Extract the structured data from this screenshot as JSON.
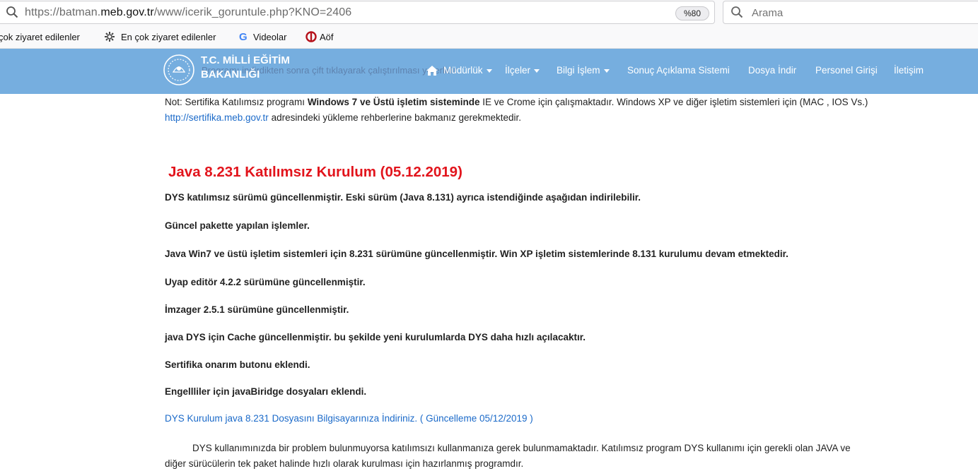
{
  "browser": {
    "url_prefix": "https://batman.",
    "url_domain": "meb.gov.tr",
    "url_suffix": "/www/icerik_goruntule.php?KNO=2406",
    "zoom": "%80",
    "search_placeholder": "Arama"
  },
  "bookmarks": [
    {
      "label": "çok ziyaret edilenler"
    },
    {
      "label": "En çok ziyaret edilenler",
      "icon": "gear-icon"
    },
    {
      "label": "Videolar",
      "icon": "google-icon"
    },
    {
      "label": "Aöf",
      "icon": "aof-icon"
    }
  ],
  "site": {
    "logo_line1": "T.C. MİLLİ EĞİTİM",
    "logo_line2": "BAKANLIĞI",
    "ghost_text": "Programı indirdikten sonra çift tıklayarak çalıştırılması yeterlidir.",
    "nav": [
      {
        "label": "Müdürlük",
        "dropdown": true
      },
      {
        "label": "İlçeler",
        "dropdown": true
      },
      {
        "label": "Bilgi İşlem",
        "dropdown": true
      },
      {
        "label": "Sonuç Açıklama Sistemi",
        "dropdown": false
      },
      {
        "label": "Dosya İndir",
        "dropdown": false
      },
      {
        "label": "Personel Girişi",
        "dropdown": false
      },
      {
        "label": "İletişim",
        "dropdown": false
      }
    ],
    "nav_color": "#76aedf"
  },
  "content": {
    "note_prefix": "Not: Sertifika Katılımsız programı ",
    "note_bold": "Windows 7 ve Üstü işletim sisteminde",
    "note_rest": " IE ve Crome için çalışmaktadır. Windows XP ve diğer işletim sistemleri için (MAC , IOS Vs.)",
    "note_link": "http://sertifika.meb.gov.tr",
    "note_link_rest": " adresindeki yükleme rehberlerine bakmanız gerekmektedir.",
    "heading": "Java 8.231 Katılımsız Kurulum (05.12.2019)",
    "bold_lines": [
      "DYS katılımsız sürümü güncellenmiştir. Eski sürüm (Java 8.131) ayrıca istendiğinde aşağıdan indirilebilir.",
      "Güncel pakette yapılan işlemler.",
      "Java Win7 ve üstü işletim sistemleri için 8.231 sürümüne güncellenmiştir. Win XP işletim sistemlerinde 8.131 kurulumu devam etmektedir.",
      "Uyap editör 4.2.2 sürümüne güncellenmiştir.",
      "İmzager 2.5.1 sürümüne güncellenmiştir.",
      "java DYS için Cache güncellenmiştir. bu şekilde yeni kurulumlarda DYS daha hızlı açılacaktır.",
      "Sertifika onarım butonu eklendi.",
      "Engellliler için javaBiridge dosyaları eklendi."
    ],
    "download_link": "DYS Kurulum java 8.231 Dosyasını Bilgisayarınıza İndiriniz.  ( Güncelleme 05/12/2019 )",
    "para_line1": "DYS kullanımınızda bir problem bulunmuyorsa katılımsızı kullanmanıza gerek bulunmamaktadır. Katılımsız program DYS kullanımı için gerekli olan JAVA ve",
    "para_line2": "diğer sürücülerin tek paket halinde hızlı olarak kurulması için hazırlanmış  programdır.",
    "heading_color": "#e2141c",
    "link_color": "#1b6ac9"
  }
}
